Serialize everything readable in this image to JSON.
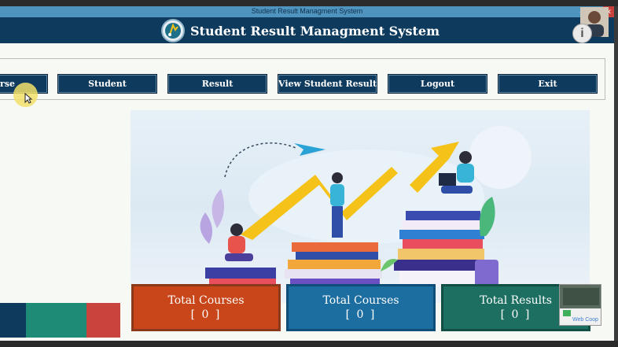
{
  "window": {
    "title": "Student Result Managment System",
    "controls": {
      "minimize": "–",
      "maximize": "▢",
      "close": "✕"
    }
  },
  "header": {
    "app_title": "Student Result Managment System"
  },
  "nav": {
    "items": [
      {
        "label": "Course"
      },
      {
        "label": "Student"
      },
      {
        "label": "Result"
      },
      {
        "label": "View Student Results"
      },
      {
        "label": "Logout"
      },
      {
        "label": "Exit"
      }
    ]
  },
  "stats": [
    {
      "label": "Total Courses",
      "value": "[ 0 ]",
      "color": "#c8461a"
    },
    {
      "label": "Total Courses",
      "value": "[ 0 ]",
      "color": "#1d6ea0"
    },
    {
      "label": "Total Results",
      "value": "[ 0 ]",
      "color": "#1d6f62"
    }
  ],
  "overlay": {
    "info_glyph": "i",
    "watermark": "Web Coop"
  },
  "colors": {
    "header_bg": "#0e3a5d",
    "titlebar_bg": "#4f93bf",
    "accent_yellow": "#f5c21a"
  }
}
